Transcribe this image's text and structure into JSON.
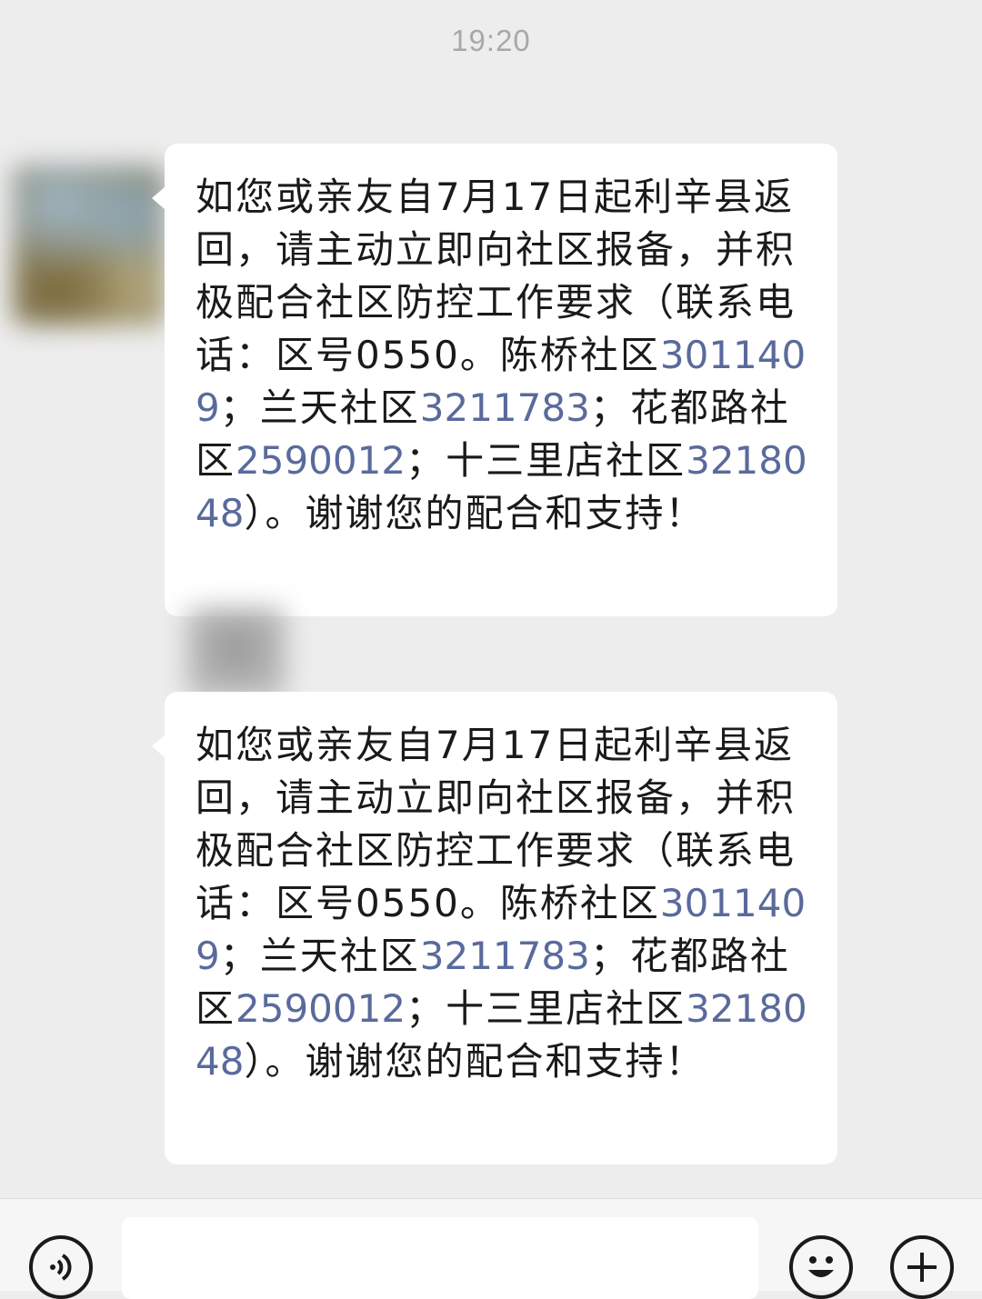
{
  "chat": {
    "timestamp": "19:20",
    "messages": [
      {
        "segments": [
          {
            "text": "如您或亲友自7月17日起利辛县返回，请主动立即向社区报备，并积极配合社区防控工作要求（联系电话：区号0550。陈桥社区",
            "type": "text"
          },
          {
            "text": "3011409",
            "type": "phone"
          },
          {
            "text": "；兰天社区",
            "type": "text"
          },
          {
            "text": "3211783",
            "type": "phone"
          },
          {
            "text": "；花都路社区",
            "type": "text"
          },
          {
            "text": "2590012",
            "type": "phone"
          },
          {
            "text": "；十三里店社区",
            "type": "text"
          },
          {
            "text": "3218048",
            "type": "phone"
          },
          {
            "text": "）。谢谢您的配合和支持！",
            "type": "text"
          }
        ]
      },
      {
        "segments": [
          {
            "text": "如您或亲友自7月17日起利辛县返回，请主动立即向社区报备，并积极配合社区防控工作要求（联系电话：区号0550。陈桥社区",
            "type": "text"
          },
          {
            "text": "3011409",
            "type": "phone"
          },
          {
            "text": "；兰天社区",
            "type": "text"
          },
          {
            "text": "3211783",
            "type": "phone"
          },
          {
            "text": "；花都路社区",
            "type": "text"
          },
          {
            "text": "2590012",
            "type": "phone"
          },
          {
            "text": "；十三里店社区",
            "type": "text"
          },
          {
            "text": "3218048",
            "type": "phone"
          },
          {
            "text": "）。谢谢您的配合和支持！",
            "type": "text"
          }
        ]
      }
    ]
  },
  "input_bar": {
    "voice_icon": "voice-icon",
    "emoji_icon": "emoji-icon",
    "plus_icon": "plus-icon",
    "input_value": ""
  },
  "colors": {
    "background": "#ededed",
    "bubble": "#ffffff",
    "phone_link": "#5a6a9c",
    "timestamp": "#a8a8a8"
  }
}
